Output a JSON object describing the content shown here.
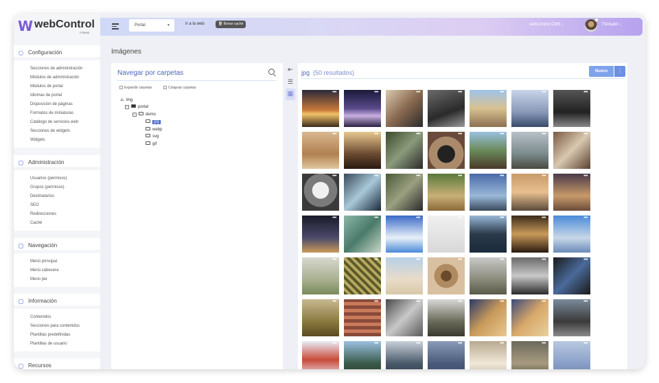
{
  "app": {
    "logo_text": "webControl",
    "logo_sub": "FORMS"
  },
  "topbar": {
    "site_select": "Portal",
    "go_web": "Ir a la web",
    "clear_cache": "🗑 Borrar caché",
    "cms_menu": "webControl CMS ↓",
    "user_menu": "Thinkabit ↓"
  },
  "sidebar": {
    "sections": [
      {
        "title": "Configuración",
        "items": [
          "Secciones de administración",
          "Módulos de administración",
          "Módulos de portal",
          "Idiomas de portal",
          "Disposición de páginas",
          "Formatos de miniaturas",
          "Catálogo de servicios web",
          "Secciones de widgets",
          "Widgets"
        ]
      },
      {
        "title": "Administración",
        "items": [
          "Usuarios (permisos)",
          "Grupos (permisos)",
          "Destinatarios",
          "SEO",
          "Redirecciones",
          "Caché"
        ]
      },
      {
        "title": "Navegación",
        "items": [
          "Menú principal",
          "Menú cabecera",
          "Menú pie"
        ]
      },
      {
        "title": "Información",
        "items": [
          "Contenidos",
          "Secciones para contenidos",
          "Plantillas predefinidas",
          "Plantillas de usuario"
        ]
      },
      {
        "title": "Recursos",
        "items": []
      }
    ]
  },
  "page": {
    "title": "Imágenes"
  },
  "folders": {
    "title": "Navegar por carpetas",
    "expand": "Expandir carpetas",
    "collapse": "Colapsar carpetas",
    "tree": {
      "root": "img",
      "portal": "portal",
      "demo": "demo",
      "children": [
        "jpg",
        "webp",
        "svg",
        "gif"
      ]
    }
  },
  "images": {
    "title": "jpg",
    "count": "(50 resultados)",
    "new_button": "Nuevo",
    "more_button": "⋮",
    "dots": "•••"
  }
}
